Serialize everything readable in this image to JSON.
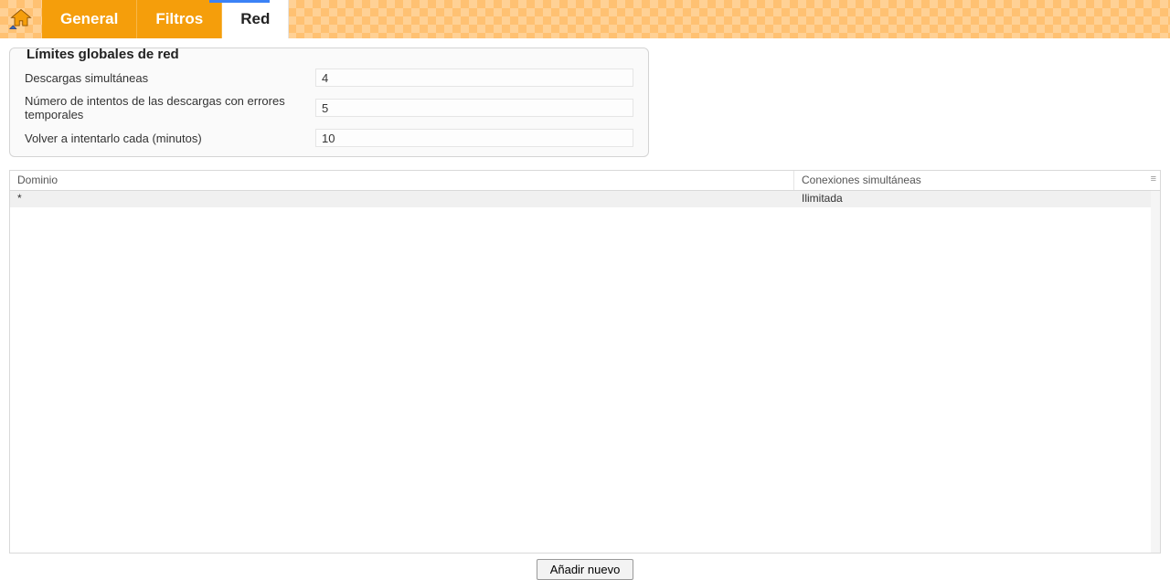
{
  "tabs": {
    "general": "General",
    "filtros": "Filtros",
    "red": "Red"
  },
  "groupbox": {
    "legend": "Límites globales de red",
    "rows": {
      "simul_label": "Descargas simultáneas",
      "simul_value": "4",
      "retries_label": "Número de intentos de las descargas con errores temporales",
      "retries_value": "5",
      "retry_every_label": "Volver a intentarlo cada (minutos)",
      "retry_every_value": "10"
    }
  },
  "table": {
    "columns": {
      "domain": "Dominio",
      "connections": "Conexiones simultáneas"
    },
    "rows": [
      {
        "domain": "*",
        "connections": "Ilimitada"
      }
    ]
  },
  "buttons": {
    "add_new": "Añadir nuevo"
  }
}
